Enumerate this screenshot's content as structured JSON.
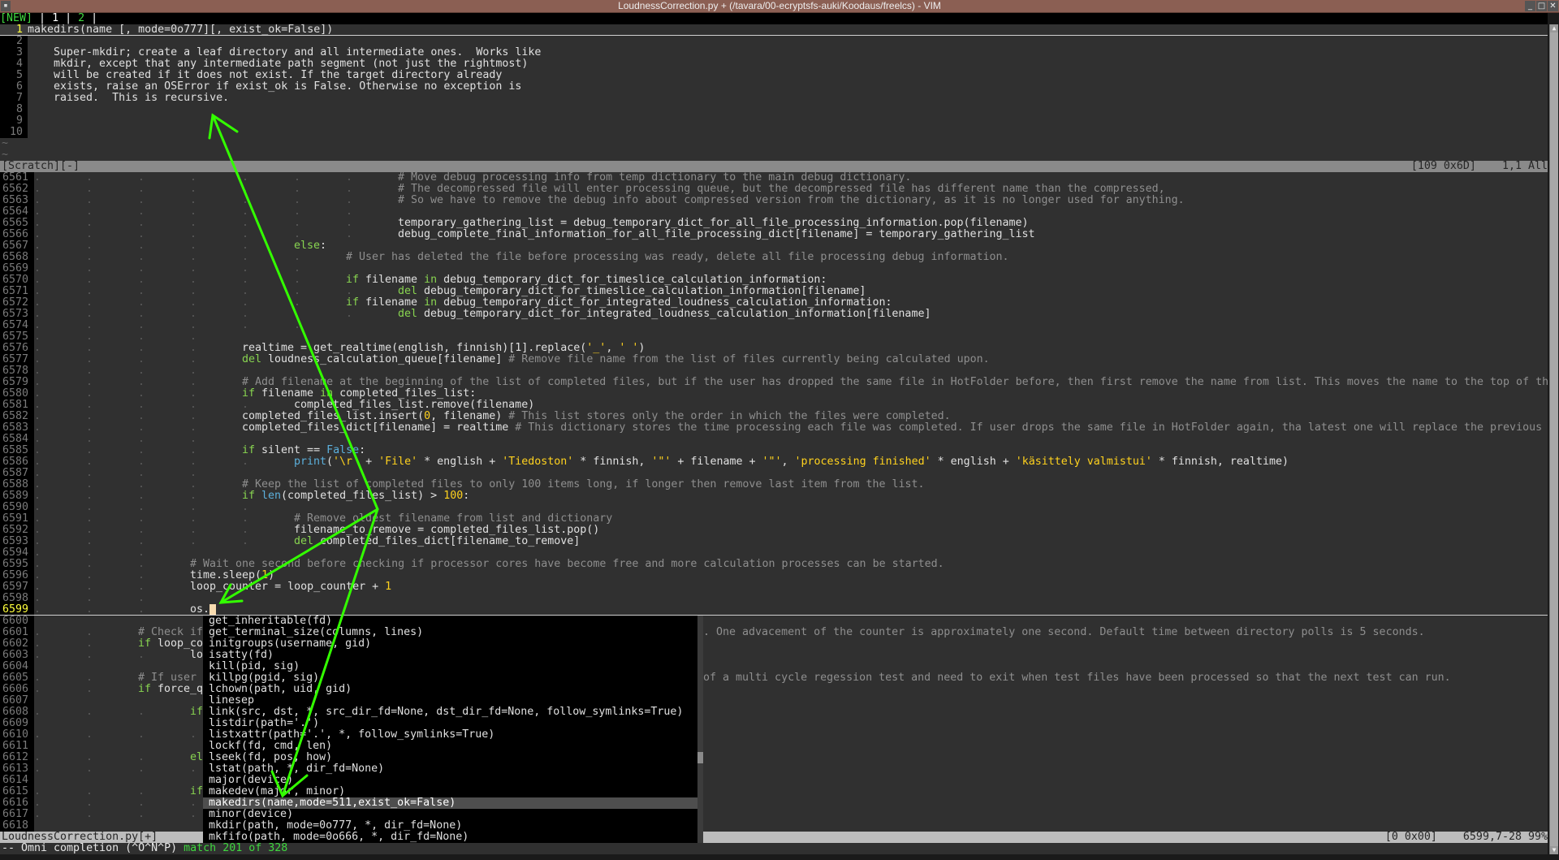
{
  "window": {
    "title": "LoudnessCorrection.py + (/tavara/00-ecryptsfs-auki/Koodaus/freelcs) - VIM",
    "controls": [
      "minimize",
      "maximize",
      "close"
    ]
  },
  "tabline": {
    "new": "[NEW]",
    "sep": " | ",
    "tab1": "1",
    "tab2": "2",
    "end": " |"
  },
  "preview": {
    "lines": [
      {
        "n": "1",
        "text": "makedirs(name [, mode=0o777][, exist_ok=False])"
      },
      {
        "n": "2",
        "text": ""
      },
      {
        "n": "3",
        "text": "    Super-mkdir; create a leaf directory and all intermediate ones.  Works like"
      },
      {
        "n": "4",
        "text": "    mkdir, except that any intermediate path segment (not just the rightmost)"
      },
      {
        "n": "5",
        "text": "    will be created if it does not exist. If the target directory already"
      },
      {
        "n": "6",
        "text": "    exists, raise an OSError if exist_ok is False. Otherwise no exception is"
      },
      {
        "n": "7",
        "text": "    raised.  This is recursive."
      },
      {
        "n": "8",
        "text": ""
      },
      {
        "n": "9",
        "text": ""
      },
      {
        "n": "10",
        "text": ""
      }
    ],
    "tilde": "~",
    "status": {
      "name": "[Scratch][-]",
      "info": "[109 0x6D]",
      "pos": "1,1 All"
    }
  },
  "main": {
    "current_line": "6599",
    "lines": [
      {
        "n": "6561",
        "i": 7,
        "t": [
          [
            "c",
            "# Move debug processing info from temp dictionary to the main debug dictionary."
          ]
        ]
      },
      {
        "n": "6562",
        "i": 7,
        "t": [
          [
            "c",
            "# The decompressed file will enter processing queue, but the decompressed file has different name than the compressed,"
          ]
        ]
      },
      {
        "n": "6563",
        "i": 7,
        "t": [
          [
            "c",
            "# So we have to remove the debug info about compressed version from the dictionary, as it is no longer used for anything."
          ]
        ]
      },
      {
        "n": "6564",
        "i": 7,
        "t": []
      },
      {
        "n": "6565",
        "i": 7,
        "t": [
          [
            "n",
            "temporary_gathering_list = debug_temporary_dict_for_all_file_processing_information.pop(filename)"
          ]
        ]
      },
      {
        "n": "6566",
        "i": 7,
        "t": [
          [
            "n",
            "debug_complete_final_information_for_all_file_processing_dict[filename] = temporary_gathering_list"
          ]
        ]
      },
      {
        "n": "6567",
        "i": 5,
        "t": [
          [
            "k",
            "else"
          ],
          [
            "n",
            ":"
          ]
        ]
      },
      {
        "n": "6568",
        "i": 6,
        "t": [
          [
            "c",
            "# User has deleted the file before processing was ready, delete all file processing debug information."
          ]
        ]
      },
      {
        "n": "6569",
        "i": 6,
        "t": []
      },
      {
        "n": "6570",
        "i": 6,
        "t": [
          [
            "k",
            "if"
          ],
          [
            "n",
            " filename "
          ],
          [
            "k",
            "in"
          ],
          [
            "n",
            " debug_temporary_dict_for_timeslice_calculation_information:"
          ]
        ]
      },
      {
        "n": "6571",
        "i": 7,
        "t": [
          [
            "k",
            "del"
          ],
          [
            "n",
            " debug_temporary_dict_for_timeslice_calculation_information[filename]"
          ]
        ]
      },
      {
        "n": "6572",
        "i": 6,
        "t": [
          [
            "k",
            "if"
          ],
          [
            "n",
            " filename "
          ],
          [
            "k",
            "in"
          ],
          [
            "n",
            " debug_temporary_dict_for_integrated_loudness_calculation_information:"
          ]
        ]
      },
      {
        "n": "6573",
        "i": 7,
        "t": [
          [
            "k",
            "del"
          ],
          [
            "n",
            " debug_temporary_dict_for_integrated_loudness_calculation_information[filename]"
          ]
        ]
      },
      {
        "n": "6574",
        "i": 6,
        "t": []
      },
      {
        "n": "6575",
        "i": 4,
        "t": []
      },
      {
        "n": "6576",
        "i": 4,
        "t": [
          [
            "n",
            "realtime = get_realtime(english, finnish)[1].replace("
          ],
          [
            "s",
            "'_'"
          ],
          [
            "n",
            ", "
          ],
          [
            "s",
            "' '"
          ],
          [
            "n",
            ")"
          ]
        ]
      },
      {
        "n": "6577",
        "i": 4,
        "t": [
          [
            "k",
            "del"
          ],
          [
            "n",
            " loudness_calculation_queue[filename] "
          ],
          [
            "c",
            "# Remove file name from the list of files currently being calculated upon."
          ]
        ]
      },
      {
        "n": "6578",
        "i": 4,
        "t": []
      },
      {
        "n": "6579",
        "i": 4,
        "t": [
          [
            "c",
            "# Add filename at the beginning of the list of completed files, but if the user has dropped the same file in HotFolder before, then first remove the name from list. This moves the name to the top of th"
          ]
        ]
      },
      {
        "n": "6580",
        "i": 4,
        "t": [
          [
            "k",
            "if"
          ],
          [
            "n",
            " filename "
          ],
          [
            "k",
            "in"
          ],
          [
            "n",
            " completed_files_list:"
          ]
        ]
      },
      {
        "n": "6581",
        "i": 5,
        "t": [
          [
            "n",
            "completed_files_list.remove(filename)"
          ]
        ]
      },
      {
        "n": "6582",
        "i": 4,
        "t": [
          [
            "n",
            "completed_files_list.insert("
          ],
          [
            "d",
            "0"
          ],
          [
            "n",
            ", filename) "
          ],
          [
            "c",
            "# This list stores only the order in which the files were completed."
          ]
        ]
      },
      {
        "n": "6583",
        "i": 4,
        "t": [
          [
            "n",
            "completed_files_dict[filename] = realtime "
          ],
          [
            "c",
            "# This dictionary stores the time processing each file was completed. If user drops the same file in HotFolder again, tha latest one will replace the previous"
          ]
        ]
      },
      {
        "n": "6584",
        "i": 4,
        "t": []
      },
      {
        "n": "6585",
        "i": 4,
        "t": [
          [
            "k",
            "if"
          ],
          [
            "n",
            " silent == "
          ],
          [
            "b",
            "False"
          ],
          [
            "n",
            ":"
          ]
        ]
      },
      {
        "n": "6586",
        "i": 5,
        "t": [
          [
            "b",
            "print"
          ],
          [
            "n",
            "("
          ],
          [
            "s",
            "'\\r'"
          ],
          [
            "n",
            " + "
          ],
          [
            "s",
            "'File'"
          ],
          [
            "n",
            " * english + "
          ],
          [
            "s",
            "'Tiedoston'"
          ],
          [
            "n",
            " * finnish, "
          ],
          [
            "s",
            "'\"'"
          ],
          [
            "n",
            " + filename + "
          ],
          [
            "s",
            "'\"'"
          ],
          [
            "n",
            ", "
          ],
          [
            "s",
            "'processing finished'"
          ],
          [
            "n",
            " * english + "
          ],
          [
            "s",
            "'käsittely valmistui'"
          ],
          [
            "n",
            " * finnish, realtime)"
          ]
        ]
      },
      {
        "n": "6587",
        "i": 4,
        "t": []
      },
      {
        "n": "6588",
        "i": 4,
        "t": [
          [
            "c",
            "# Keep the list of completed files to only 100 items long, if longer then remove last item from the list."
          ]
        ]
      },
      {
        "n": "6589",
        "i": 4,
        "t": [
          [
            "k",
            "if"
          ],
          [
            "b",
            " len"
          ],
          [
            "n",
            "(completed_files_list) > "
          ],
          [
            "d",
            "100"
          ],
          [
            "n",
            ":"
          ]
        ]
      },
      {
        "n": "6590",
        "i": 5,
        "t": []
      },
      {
        "n": "6591",
        "i": 5,
        "t": [
          [
            "c",
            "# Remove oldest filename from list and dictionary"
          ]
        ]
      },
      {
        "n": "6592",
        "i": 5,
        "t": [
          [
            "n",
            "filename_to_remove = completed_files_list.pop()"
          ]
        ]
      },
      {
        "n": "6593",
        "i": 5,
        "t": [
          [
            "k",
            "del"
          ],
          [
            "n",
            " completed_files_dict[filename_to_remove]"
          ]
        ]
      },
      {
        "n": "6594",
        "i": 3,
        "t": []
      },
      {
        "n": "6595",
        "i": 3,
        "t": [
          [
            "c",
            "# Wait one second before checking if processor cores have become free and more calculation processes can be started."
          ]
        ]
      },
      {
        "n": "6596",
        "i": 3,
        "t": [
          [
            "n",
            "time.sleep("
          ],
          [
            "d",
            "1"
          ],
          [
            "n",
            ")"
          ]
        ]
      },
      {
        "n": "6597",
        "i": 3,
        "t": [
          [
            "n",
            "loop_counter = loop_counter + "
          ],
          [
            "d",
            "1"
          ]
        ]
      },
      {
        "n": "6598",
        "i": 3,
        "t": []
      },
      {
        "n": "6599",
        "i": 3,
        "t": [
          [
            "n",
            "os."
          ]
        ],
        "cursor": true
      },
      {
        "n": "6600",
        "i": 0,
        "t": []
      },
      {
        "n": "6601",
        "i": 2,
        "t": [
          [
            "c",
            "# Check if"
          ]
        ],
        "tail": [
          [
            "c",
            ". One advacement of the counter is approximately one second. Default time between directory polls is 5 seconds."
          ]
        ]
      },
      {
        "n": "6602",
        "i": 2,
        "t": [
          [
            "k",
            "if"
          ],
          [
            "n",
            " loop_co"
          ]
        ]
      },
      {
        "n": "6603",
        "i": 3,
        "t": [
          [
            "n",
            "lo"
          ]
        ]
      },
      {
        "n": "6604",
        "i": 0,
        "t": []
      },
      {
        "n": "6605",
        "i": 2,
        "t": [
          [
            "c",
            "# If user"
          ]
        ],
        "tail": [
          [
            "c",
            "of a multi cycle regession test and need to exit when test files have been processed so that the next test can run."
          ]
        ]
      },
      {
        "n": "6606",
        "i": 2,
        "t": [
          [
            "k",
            "if"
          ],
          [
            "n",
            " force_q"
          ]
        ]
      },
      {
        "n": "6607",
        "i": 0,
        "t": []
      },
      {
        "n": "6608",
        "i": 3,
        "t": [
          [
            "k",
            "if"
          ]
        ]
      },
      {
        "n": "6609",
        "i": 0,
        "t": []
      },
      {
        "n": "6610",
        "i": 4,
        "t": []
      },
      {
        "n": "6611",
        "i": 0,
        "t": []
      },
      {
        "n": "6612",
        "i": 3,
        "t": [
          [
            "k",
            "el"
          ]
        ]
      },
      {
        "n": "6613",
        "i": 4,
        "t": []
      },
      {
        "n": "6614",
        "i": 0,
        "t": []
      },
      {
        "n": "6615",
        "i": 3,
        "t": [
          [
            "k",
            "if"
          ]
        ]
      },
      {
        "n": "6616",
        "i": 4,
        "t": []
      },
      {
        "n": "6617",
        "i": 4,
        "t": []
      },
      {
        "n": "6618",
        "i": 0,
        "t": []
      }
    ],
    "status": {
      "name": "LoudnessCorrection.py[+]",
      "info": "[0 0x00]",
      "pos": "6599,7-28 99%"
    }
  },
  "popup": {
    "selected_index": 16,
    "items": [
      "get_inheritable(fd)",
      "get_terminal_size(columns, lines)",
      "initgroups(username, gid)",
      "isatty(fd)",
      "kill(pid, sig)",
      "killpg(pgid, sig)",
      "lchown(path, uid, gid)",
      "linesep",
      "link(src, dst, *, src_dir_fd=None, dst_dir_fd=None, follow_symlinks=True)",
      "listdir(path='.')",
      "listxattr(path='.', *, follow_symlinks=True)",
      "lockf(fd, cmd, len)",
      "lseek(fd, pos, how)",
      "lstat(path, *, dir_fd=None)",
      "major(device)",
      "makedev(major, minor)",
      "makedirs(name,mode=511,exist_ok=False)",
      "minor(device)",
      "mkdir(path, mode=0o777, *, dir_fd=None)",
      "mkfifo(path, mode=0o666, *, dir_fd=None)"
    ]
  },
  "cmdline": {
    "mode": "-- Omni completion (^O^N^P)",
    "match": " match 201 of 328"
  },
  "colors": {
    "keyword": "#88d450",
    "comment": "#8e8e8e",
    "string": "#ffd21e",
    "builtin": "#5cb0dc",
    "background": "#303030",
    "titlebar": "#8b5f53",
    "annotation_arrows": "#33ff00"
  }
}
